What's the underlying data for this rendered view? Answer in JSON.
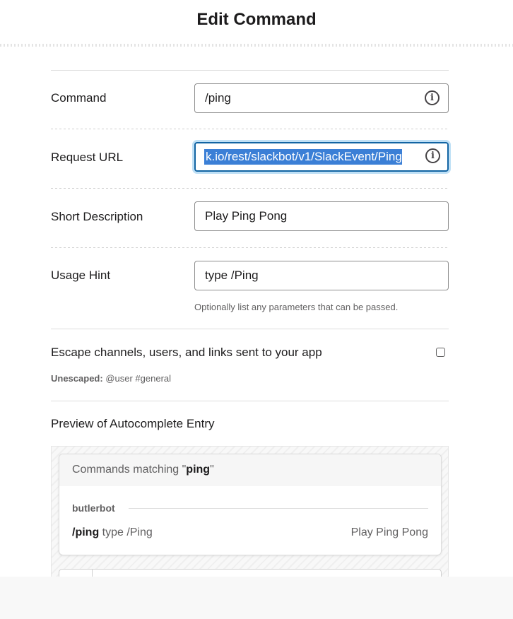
{
  "modal": {
    "title": "Edit Command"
  },
  "form": {
    "command": {
      "label": "Command",
      "value": "/ping"
    },
    "request_url": {
      "label": "Request URL",
      "value": "k.io/rest/slackbot/v1/SlackEvent/Ping"
    },
    "short_description": {
      "label": "Short Description",
      "value": "Play Ping Pong"
    },
    "usage_hint": {
      "label": "Usage Hint",
      "value": "type /Ping",
      "help": "Optionally list any parameters that can be passed."
    },
    "escape": {
      "label": "Escape channels, users, and links sent to your app",
      "checked": false,
      "status_label": "Unescaped:",
      "example": "@user #general"
    }
  },
  "preview": {
    "label": "Preview of Autocomplete Entry",
    "header_prefix": "Commands matching \"",
    "header_term": "ping",
    "header_suffix": "\"",
    "app_name": "butlerbot",
    "command": "/ping",
    "hint": "type /Ping",
    "description": "Play Ping Pong"
  },
  "icons": {
    "info": "info-icon",
    "checkbox": "checkbox"
  },
  "colors": {
    "focus_border": "#1264a3",
    "selection": "#3b7fd6",
    "focus_glow": "#bfe0f6"
  }
}
